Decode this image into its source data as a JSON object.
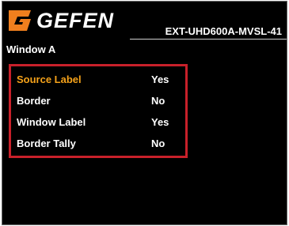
{
  "header": {
    "brand": "GEFEN",
    "model": "EXT-UHD600A-MVSL-41"
  },
  "window_title": "Window A",
  "menu": {
    "items": [
      {
        "label": "Source Label",
        "value": "Yes",
        "selected": true
      },
      {
        "label": "Border",
        "value": "No",
        "selected": false
      },
      {
        "label": "Window Label",
        "value": "Yes",
        "selected": false
      },
      {
        "label": "Border Tally",
        "value": "No",
        "selected": false
      }
    ]
  },
  "colors": {
    "background": "#000000",
    "text": "#ffffff",
    "highlight": "#f5a21a",
    "selection_border": "#c8202a",
    "logo_orange": "#f07f1e"
  }
}
